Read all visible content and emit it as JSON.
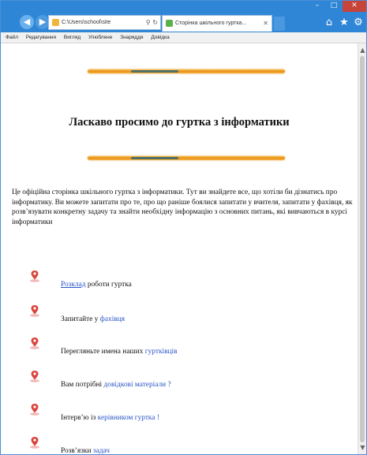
{
  "browser": {
    "address_text": "C:\\Users\\school\\site",
    "tab_title": "Сторінка шкільного гуртка...",
    "menu": [
      "Файл",
      "Редагування",
      "Вигляд",
      "Улюблене",
      "Знаряддя",
      "Довідка"
    ]
  },
  "page": {
    "title": "Ласкаво просимо до гуртка з інформатики",
    "intro": "Це офіційна сторінка шкільного гуртка з інформатики. Тут ви знайдете все, що хотіли би дізнатись про інформатику. Ви можете запитати про те, про що раніше боялися запитати у вчителя, запитати у фахівця, як розв’язувати конкретну задачу та знайти необхідну інформацію з основних питань, які вивчаються в курсі інформатики",
    "items": [
      {
        "before": "",
        "link": "Розклад",
        "after": " роботи гуртка",
        "style": "underline"
      },
      {
        "before": "Запитайте у ",
        "link": "фахівця",
        "after": "",
        "style": "plain"
      },
      {
        "before": "Перегляньте имена наших ",
        "link": "гуртківців",
        "after": "",
        "style": "plain"
      },
      {
        "before": "Вам потрібні ",
        "link": "довідкові матеріали ?",
        "after": "",
        "style": "plain"
      },
      {
        "before": "Інтерв’ю із ",
        "link": "керівником гуртка !",
        "after": "",
        "style": "plain"
      },
      {
        "before": "Розв’язки ",
        "link": "задач",
        "after": "",
        "style": "plain"
      }
    ]
  },
  "colors": {
    "titlebar": "#2f86d6",
    "link": "#2a55c8",
    "divider": "#e8901a",
    "pin": "#d9453d"
  },
  "icons": [
    "back-icon",
    "forward-icon",
    "home-icon",
    "star-icon",
    "gear-icon",
    "map-pin-icon"
  ]
}
